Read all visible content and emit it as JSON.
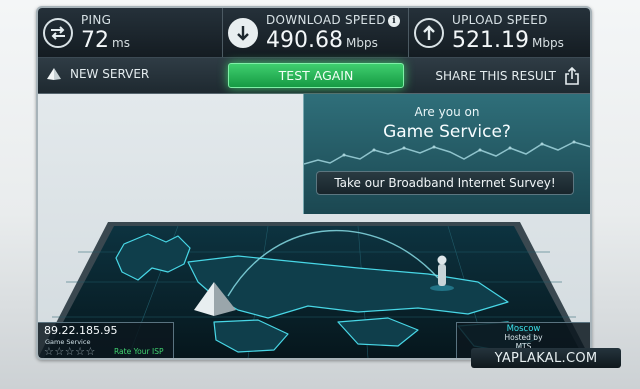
{
  "stats": {
    "ping": {
      "label": "PING",
      "value": "72",
      "unit": "ms",
      "icon": "arrows-swap-icon"
    },
    "download": {
      "label": "DOWNLOAD SPEED",
      "value": "490.68",
      "unit": "Mbps",
      "icon": "arrow-down-icon",
      "info": "i"
    },
    "upload": {
      "label": "UPLOAD SPEED",
      "value": "521.19",
      "unit": "Mbps",
      "icon": "arrow-up-icon"
    }
  },
  "actions": {
    "new_server": "NEW SERVER",
    "test_again": "TEST AGAIN",
    "share": "SHARE THIS RESULT"
  },
  "survey": {
    "question": "Are you on",
    "title": "Game Service?",
    "button": "Take our Broadband Internet Survey!"
  },
  "server": {
    "ip": "89.22.185.95",
    "isp": "Game Service",
    "stars": "☆☆☆☆☆",
    "rate_label": "Rate Your ISP"
  },
  "host": {
    "city": "Moscow",
    "hosted_by": "Hosted by",
    "host_name": "MTS"
  },
  "watermark": "YAPLAKAL.COM",
  "colors": {
    "accent_green": "#1fb450",
    "panel_dark": "#1b252c",
    "survey_teal": "#256070",
    "map_cyan": "#3be0e8"
  }
}
